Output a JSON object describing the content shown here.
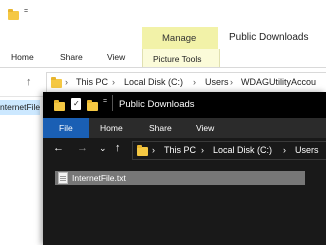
{
  "background_window": {
    "qa_dropdown_glyph": "=",
    "ribbon_tabs": [
      "Home",
      "Share",
      "View"
    ],
    "contextual_tab": "Manage",
    "contextual_subtab": "Picture Tools",
    "title": "Public Downloads",
    "nav_up_glyph": "↑",
    "address_sep": "›",
    "breadcrumbs": [
      "This PC",
      "Local Disk (C:)",
      "Users",
      "WDAGUtilityAccou"
    ],
    "file_partial": "nternetFile"
  },
  "dark_window": {
    "qa_dropdown_glyph": "=",
    "title": "Public Downloads",
    "tabs": {
      "file": "File",
      "home": "Home",
      "share": "Share",
      "view": "View"
    },
    "nav": {
      "back": "←",
      "forward": "→",
      "recent": "⌄",
      "up": "↑"
    },
    "address_sep": "›",
    "breadcrumbs": [
      "This PC",
      "Local Disk (C:)",
      "Users"
    ],
    "file_name": "InternetFile.txt"
  },
  "icons": {
    "folder": "folder-icon",
    "checkmark": "check-icon",
    "text_file": "text-file-icon"
  },
  "colors": {
    "contextual_tab": "#f2f2a8",
    "file_tab": "#1a5fb4",
    "dark_background": "#191919",
    "selection": "#777777"
  }
}
